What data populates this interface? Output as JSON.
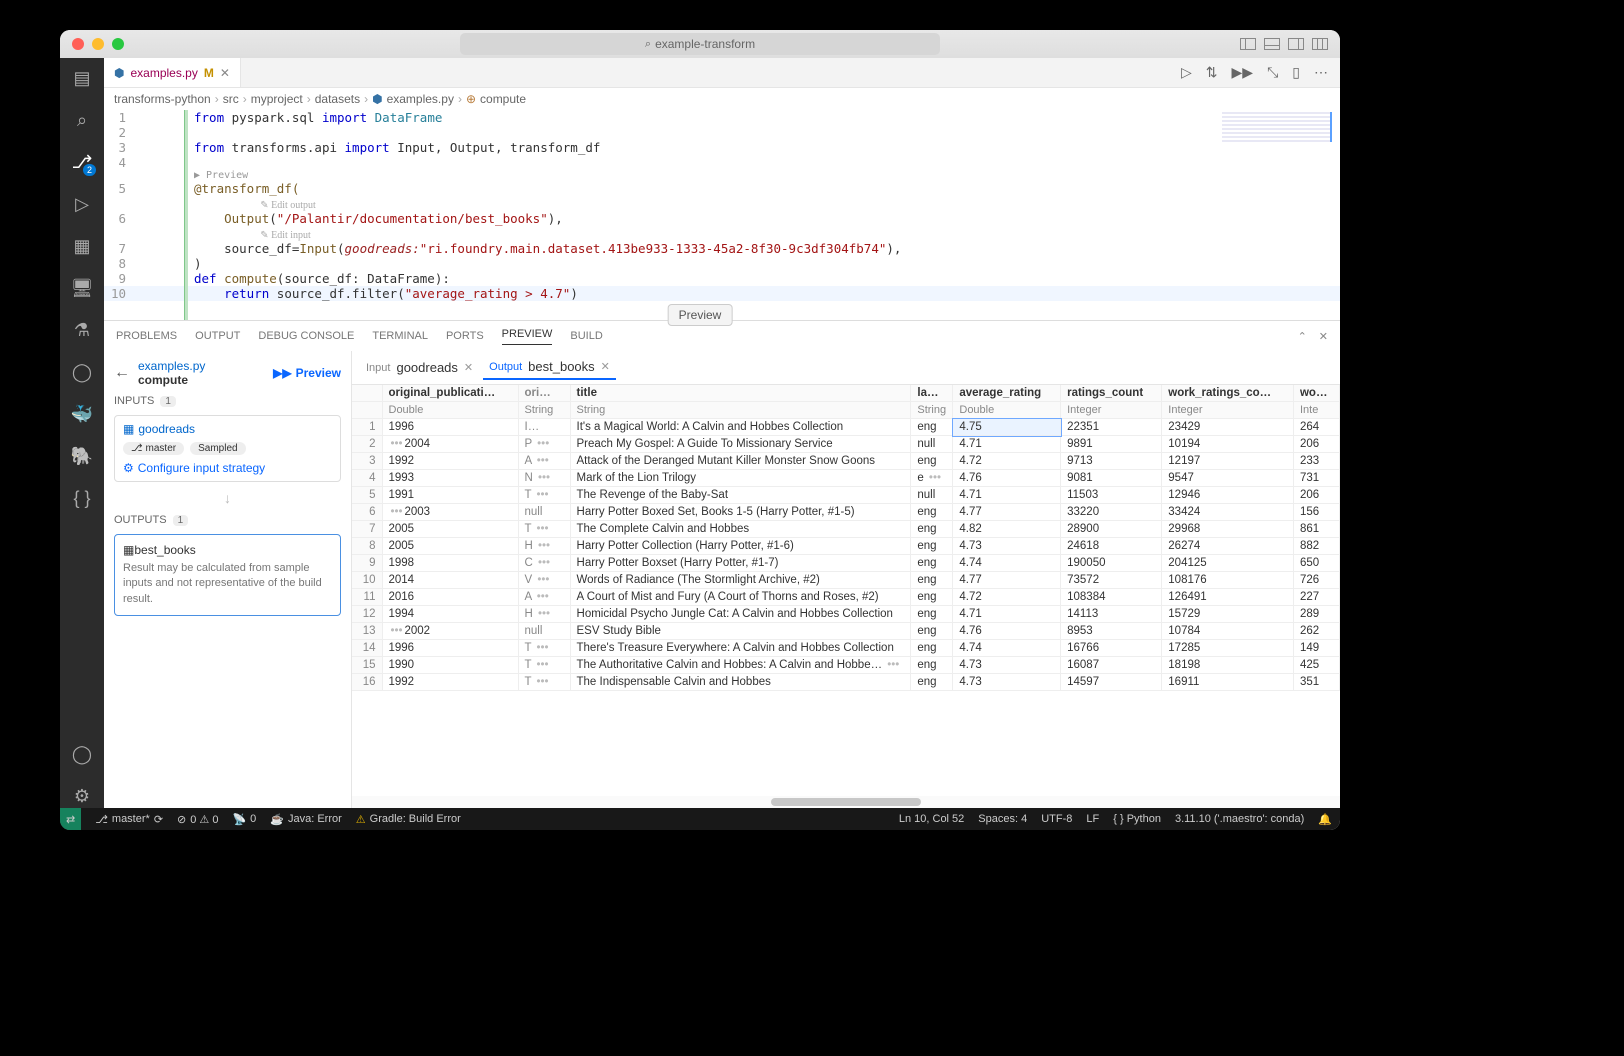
{
  "titlebar": {
    "search": "example-transform"
  },
  "activity_badge": "2",
  "tab": {
    "filename": "examples.py",
    "mod": "M"
  },
  "tab_actions": [
    "▷",
    "⇅",
    "▶▶",
    "⤡",
    "▯",
    "⋯"
  ],
  "breadcrumbs": [
    "transforms-python",
    "src",
    "myproject",
    "datasets",
    "examples.py",
    "compute"
  ],
  "code": {
    "l1": {
      "kw1": "from",
      "mod": "pyspark.sql",
      "kw2": "import",
      "name": "DataFrame"
    },
    "l3": {
      "kw1": "from",
      "mod": "transforms.api",
      "kw2": "import",
      "names": "Input, Output, transform_df"
    },
    "codelens_preview": "▶ Preview",
    "l5": "@transform_df(",
    "hint_out": "✎ Edit output",
    "l6_fn": "Output",
    "l6_str": "\"/Palantir/documentation/best_books\"",
    "l6_tail": "),",
    "hint_in": "✎ Edit input",
    "l7_a": "    source_df=",
    "l7_fn": "Input",
    "l7_prm": "goodreads:",
    "l7_str": "\"ri.foundry.main.dataset.413be933-1333-45a2-8f30-9c3df304fb74\"",
    "l7_tail": "),",
    "l8": ")",
    "l9_kw": "def",
    "l9_fn": "compute",
    "l9_sig": "(source_df: DataFrame):",
    "l10_kw": "return",
    "l10_body": " source_df.filter(",
    "l10_str": "\"average_rating > 4.7\"",
    "l10_tail": ")"
  },
  "preview_pill": "Preview",
  "panel_tabs": [
    "PROBLEMS",
    "OUTPUT",
    "DEBUG CONSOLE",
    "TERMINAL",
    "PORTS",
    "PREVIEW",
    "BUILD"
  ],
  "panel_active": 5,
  "side": {
    "file": "examples.py",
    "func": "compute",
    "run": "Preview",
    "inputs_label": "INPUTS",
    "inputs_count": "1",
    "input_ds": "goodreads",
    "chip_branch": "master",
    "chip_sampled": "Sampled",
    "configure": "Configure input strategy",
    "outputs_label": "OUTPUTS",
    "outputs_count": "1",
    "output_ds": "best_books",
    "output_note": "Result may be calculated from sample inputs and not representative of the build result."
  },
  "dtabs": {
    "in_lbl": "Input",
    "in_val": "goodreads",
    "out_lbl": "Output",
    "out_val": "best_books"
  },
  "columns": [
    {
      "name": "",
      "type": ""
    },
    {
      "name": "original_publicati…",
      "type": "Double"
    },
    {
      "name": "ori…",
      "type": "String"
    },
    {
      "name": "title",
      "type": "String"
    },
    {
      "name": "la…",
      "type": "String"
    },
    {
      "name": "average_rating",
      "type": "Double"
    },
    {
      "name": "ratings_count",
      "type": "Integer"
    },
    {
      "name": "work_ratings_co…",
      "type": "Integer"
    },
    {
      "name": "wo…",
      "type": "Inte"
    }
  ],
  "rows": [
    {
      "n": 1,
      "y": "1996",
      "o": "I…",
      "t": "It's a Magical World: A Calvin and Hobbes Collection",
      "l": "eng",
      "r": "4.75",
      "rc": "22351",
      "wrc": "23429",
      "w": "264"
    },
    {
      "n": 2,
      "el": "•••",
      "y": "2004",
      "o": "P",
      "oe": "•••",
      "t": "Preach My Gospel: A Guide To Missionary Service",
      "l": "null",
      "r": "4.71",
      "rc": "9891",
      "wrc": "10194",
      "w": "206"
    },
    {
      "n": 3,
      "y": "1992",
      "o": "A",
      "oe": "•••",
      "t": "Attack of the Deranged Mutant Killer Monster Snow Goons",
      "l": "eng",
      "r": "4.72",
      "rc": "9713",
      "wrc": "12197",
      "w": "233"
    },
    {
      "n": 4,
      "y": "1993",
      "o": "N",
      "oe": "•••",
      "t": "Mark of the Lion Trilogy",
      "l": "e",
      "le": "•••",
      "r": "4.76",
      "rc": "9081",
      "wrc": "9547",
      "w": "731"
    },
    {
      "n": 5,
      "y": "1991",
      "o": "T",
      "oe": "•••",
      "t": "The Revenge of the Baby-Sat",
      "l": "null",
      "r": "4.71",
      "rc": "11503",
      "wrc": "12946",
      "w": "206"
    },
    {
      "n": 6,
      "el": "•••",
      "y": "2003",
      "o": "null",
      "t": "Harry Potter Boxed Set, Books 1-5 (Harry Potter, #1-5)",
      "l": "eng",
      "r": "4.77",
      "rc": "33220",
      "wrc": "33424",
      "w": "156"
    },
    {
      "n": 7,
      "y": "2005",
      "o": "T",
      "oe": "•••",
      "t": "The Complete Calvin and Hobbes",
      "l": "eng",
      "r": "4.82",
      "rc": "28900",
      "wrc": "29968",
      "w": "861"
    },
    {
      "n": 8,
      "y": "2005",
      "o": "H",
      "oe": "•••",
      "t": "Harry Potter Collection (Harry Potter, #1-6)",
      "l": "eng",
      "r": "4.73",
      "rc": "24618",
      "wrc": "26274",
      "w": "882"
    },
    {
      "n": 9,
      "y": "1998",
      "o": "C",
      "oe": "•••",
      "t": "Harry Potter Boxset (Harry Potter, #1-7)",
      "l": "eng",
      "r": "4.74",
      "rc": "190050",
      "wrc": "204125",
      "w": "650"
    },
    {
      "n": 10,
      "y": "2014",
      "o": "V",
      "oe": "•••",
      "t": "Words of Radiance (The Stormlight Archive, #2)",
      "l": "eng",
      "r": "4.77",
      "rc": "73572",
      "wrc": "108176",
      "w": "726"
    },
    {
      "n": 11,
      "y": "2016",
      "o": "A",
      "oe": "•••",
      "t": "A Court of Mist and Fury (A Court of Thorns and Roses, #2)",
      "l": "eng",
      "r": "4.72",
      "rc": "108384",
      "wrc": "126491",
      "w": "227"
    },
    {
      "n": 12,
      "y": "1994",
      "o": "H",
      "oe": "•••",
      "t": "Homicidal Psycho Jungle Cat: A Calvin and Hobbes Collection",
      "l": "eng",
      "r": "4.71",
      "rc": "14113",
      "wrc": "15729",
      "w": "289"
    },
    {
      "n": 13,
      "el": "•••",
      "y": "2002",
      "o": "null",
      "t": "ESV Study Bible",
      "l": "eng",
      "r": "4.76",
      "rc": "8953",
      "wrc": "10784",
      "w": "262"
    },
    {
      "n": 14,
      "y": "1996",
      "o": "T",
      "oe": "•••",
      "t": "There's Treasure Everywhere: A Calvin and Hobbes Collection",
      "l": "eng",
      "r": "4.74",
      "rc": "16766",
      "wrc": "17285",
      "w": "149"
    },
    {
      "n": 15,
      "y": "1990",
      "o": "T",
      "oe": "•••",
      "t": "The Authoritative Calvin and Hobbes: A Calvin and Hobbe…",
      "te": "•••",
      "l": "eng",
      "r": "4.73",
      "rc": "16087",
      "wrc": "18198",
      "w": "425"
    },
    {
      "n": 16,
      "y": "1992",
      "o": "T",
      "oe": "•••",
      "t": "The Indispensable Calvin and Hobbes",
      "l": "eng",
      "r": "4.73",
      "rc": "14597",
      "wrc": "16911",
      "w": "351"
    }
  ],
  "status": {
    "branch": "master*",
    "errwarn": "0 ⚠ 0",
    "radio": "0",
    "java": "Java: Error",
    "gradle": "Gradle: Build Error",
    "pos": "Ln 10, Col 52",
    "spaces": "Spaces: 4",
    "enc": "UTF-8",
    "eol": "LF",
    "lang": "Python",
    "py": "3.11.10 ('.maestro': conda)"
  }
}
